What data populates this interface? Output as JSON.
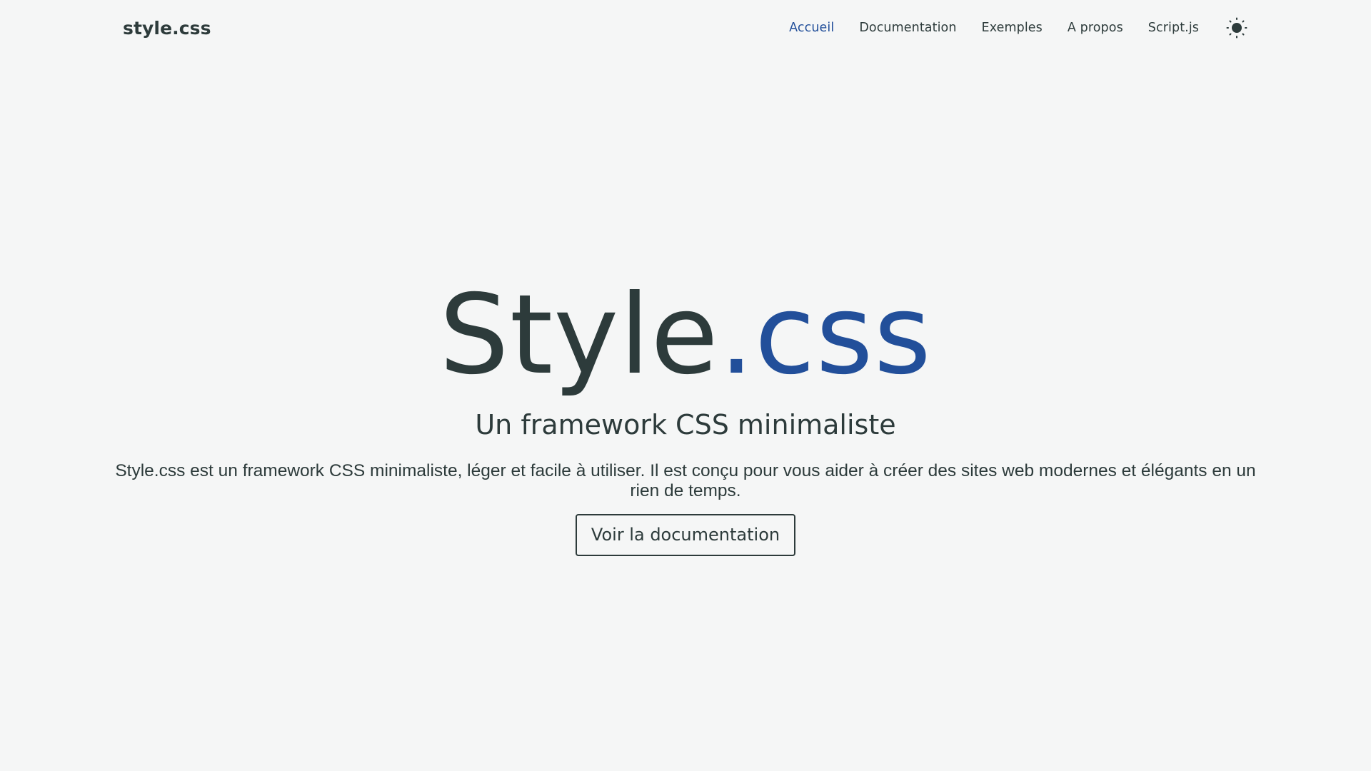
{
  "header": {
    "brand": "style.css",
    "nav": [
      {
        "label": "Accueil",
        "active": true
      },
      {
        "label": "Documentation",
        "active": false
      },
      {
        "label": "Exemples",
        "active": false
      },
      {
        "label": "A propos",
        "active": false
      },
      {
        "label": "Script.js",
        "active": false
      }
    ],
    "theme_toggle_icon": "sun-icon"
  },
  "hero": {
    "title_main": "Style",
    "title_accent": ".css",
    "subtitle": "Un framework CSS minimaliste",
    "description": "Style.css est un framework CSS minimaliste, léger et facile à utiliser. Il est conçu pour vous aider à créer des sites web modernes et élégants en un rien de temps.",
    "cta_label": "Voir la documentation"
  },
  "colors": {
    "background": "#f5f6f6",
    "text": "#2d3b3b",
    "accent": "#224f9a"
  }
}
